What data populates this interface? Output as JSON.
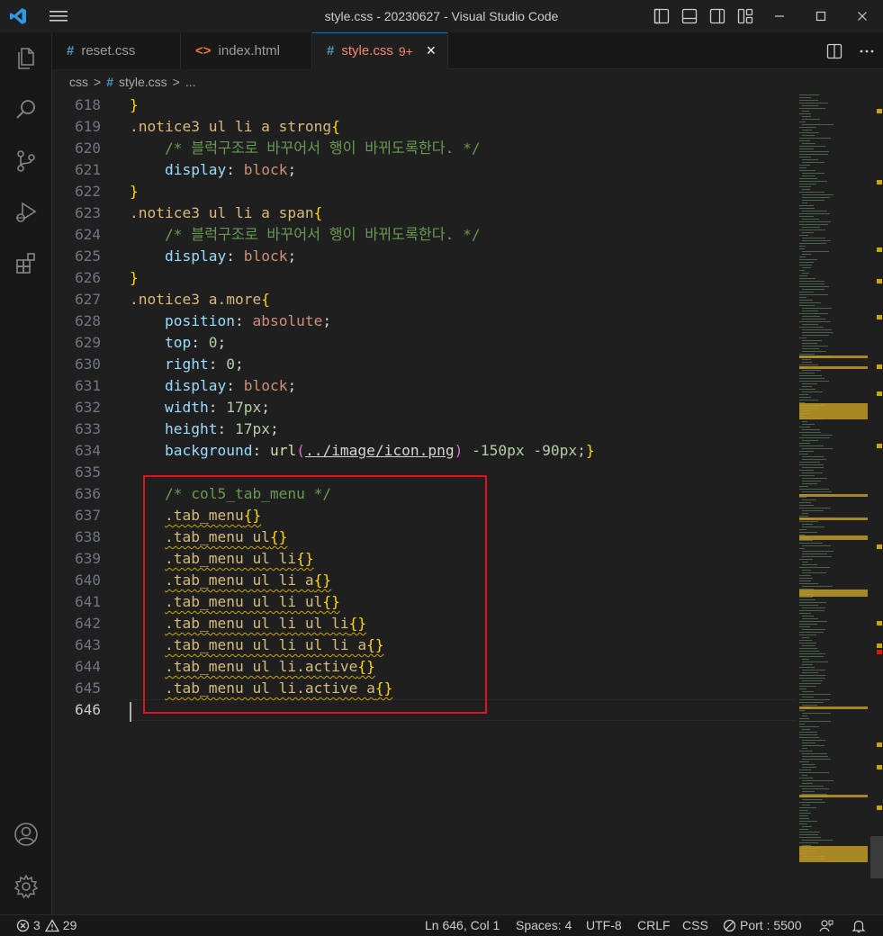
{
  "window": {
    "title": "style.css - 20230627 - Visual Studio Code"
  },
  "tabs": [
    {
      "label": "reset.css",
      "icon": "#",
      "active": false
    },
    {
      "label": "index.html",
      "icon": "<>",
      "active": false
    },
    {
      "label": "style.css",
      "icon": "#",
      "badge": "9+",
      "active": true
    }
  ],
  "breadcrumb": {
    "folder": "css",
    "sep": ">",
    "file_icon": "#",
    "file": "style.css",
    "more": "..."
  },
  "line_numbers": [
    "618",
    "619",
    "620",
    "621",
    "622",
    "623",
    "624",
    "625",
    "626",
    "627",
    "628",
    "629",
    "630",
    "631",
    "632",
    "633",
    "634",
    "635",
    "636",
    "637",
    "638",
    "639",
    "640",
    "641",
    "642",
    "643",
    "644",
    "645",
    "646"
  ],
  "code": {
    "l618": "}",
    "l619_sel": ".notice3 ul li a strong",
    "l619_br": "{",
    "l620_cm": "/* 블럭구조로 바꾸어서 행이 바뀌도록한다. */",
    "l621_prop": "display",
    "l621_val": "block",
    "l622": "}",
    "l623_sel": ".notice3 ul li a span",
    "l623_br": "{",
    "l624_cm": "/* 블럭구조로 바꾸어서 행이 바뀌도록한다. */",
    "l625_prop": "display",
    "l625_val": "block",
    "l626": "}",
    "l627_sel": ".notice3 a.more",
    "l627_br": "{",
    "l628_prop": "position",
    "l628_val": "absolute",
    "l629_prop": "top",
    "l629_val": "0",
    "l630_prop": "right",
    "l630_val": "0",
    "l631_prop": "display",
    "l631_val": "block",
    "l632_prop": "width",
    "l632_val": "17px",
    "l633_prop": "height",
    "l633_val": "17px",
    "l634_prop": "background",
    "l634_fn": "url",
    "l634_path": "../image/icon.png",
    "l634_rest": " -150px -90px;",
    "l634_close": "}",
    "l636_cm": "/* col5_tab_menu */",
    "l637_sel": ".tab_menu",
    "l638_sel": ".tab_menu ul",
    "l639_sel": ".tab_menu ul li",
    "l640_sel": ".tab_menu ul li a",
    "l641_sel": ".tab_menu ul li ul",
    "l642_sel": ".tab_menu ul li ul li",
    "l643_sel": ".tab_menu ul li ul li a",
    "l644_sel": ".tab_menu ul li.active",
    "l645_sel": ".tab_menu ul li.active a",
    "empty_rule": "{}"
  },
  "status": {
    "errors": "3",
    "warnings": "29",
    "position": "Ln 646, Col 1",
    "spaces": "Spaces: 4",
    "encoding": "UTF-8",
    "eol": "CRLF",
    "language": "CSS",
    "port": "Port : 5500"
  },
  "colors": {
    "accent": "#0078d4",
    "highlight_box": "#e0141e",
    "warning": "#cca700",
    "tab_modified": "#f48771"
  },
  "icons": {
    "vscode": "vscode-logo-icon",
    "explorer": "files-icon",
    "search": "search-icon",
    "scm": "source-control-icon",
    "debug": "run-debug-icon",
    "extensions": "extensions-icon",
    "account": "account-icon",
    "settings": "gear-icon"
  }
}
